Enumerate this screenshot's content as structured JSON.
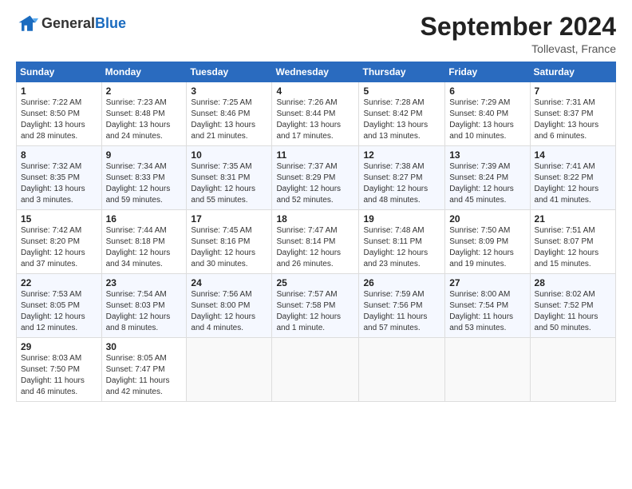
{
  "header": {
    "logo_general": "General",
    "logo_blue": "Blue",
    "month_title": "September 2024",
    "location": "Tollevast, France"
  },
  "weekdays": [
    "Sunday",
    "Monday",
    "Tuesday",
    "Wednesday",
    "Thursday",
    "Friday",
    "Saturday"
  ],
  "weeks": [
    [
      {
        "day": "1",
        "lines": [
          "Sunrise: 7:22 AM",
          "Sunset: 8:50 PM",
          "Daylight: 13 hours",
          "and 28 minutes."
        ]
      },
      {
        "day": "2",
        "lines": [
          "Sunrise: 7:23 AM",
          "Sunset: 8:48 PM",
          "Daylight: 13 hours",
          "and 24 minutes."
        ]
      },
      {
        "day": "3",
        "lines": [
          "Sunrise: 7:25 AM",
          "Sunset: 8:46 PM",
          "Daylight: 13 hours",
          "and 21 minutes."
        ]
      },
      {
        "day": "4",
        "lines": [
          "Sunrise: 7:26 AM",
          "Sunset: 8:44 PM",
          "Daylight: 13 hours",
          "and 17 minutes."
        ]
      },
      {
        "day": "5",
        "lines": [
          "Sunrise: 7:28 AM",
          "Sunset: 8:42 PM",
          "Daylight: 13 hours",
          "and 13 minutes."
        ]
      },
      {
        "day": "6",
        "lines": [
          "Sunrise: 7:29 AM",
          "Sunset: 8:40 PM",
          "Daylight: 13 hours",
          "and 10 minutes."
        ]
      },
      {
        "day": "7",
        "lines": [
          "Sunrise: 7:31 AM",
          "Sunset: 8:37 PM",
          "Daylight: 13 hours",
          "and 6 minutes."
        ]
      }
    ],
    [
      {
        "day": "8",
        "lines": [
          "Sunrise: 7:32 AM",
          "Sunset: 8:35 PM",
          "Daylight: 13 hours",
          "and 3 minutes."
        ]
      },
      {
        "day": "9",
        "lines": [
          "Sunrise: 7:34 AM",
          "Sunset: 8:33 PM",
          "Daylight: 12 hours",
          "and 59 minutes."
        ]
      },
      {
        "day": "10",
        "lines": [
          "Sunrise: 7:35 AM",
          "Sunset: 8:31 PM",
          "Daylight: 12 hours",
          "and 55 minutes."
        ]
      },
      {
        "day": "11",
        "lines": [
          "Sunrise: 7:37 AM",
          "Sunset: 8:29 PM",
          "Daylight: 12 hours",
          "and 52 minutes."
        ]
      },
      {
        "day": "12",
        "lines": [
          "Sunrise: 7:38 AM",
          "Sunset: 8:27 PM",
          "Daylight: 12 hours",
          "and 48 minutes."
        ]
      },
      {
        "day": "13",
        "lines": [
          "Sunrise: 7:39 AM",
          "Sunset: 8:24 PM",
          "Daylight: 12 hours",
          "and 45 minutes."
        ]
      },
      {
        "day": "14",
        "lines": [
          "Sunrise: 7:41 AM",
          "Sunset: 8:22 PM",
          "Daylight: 12 hours",
          "and 41 minutes."
        ]
      }
    ],
    [
      {
        "day": "15",
        "lines": [
          "Sunrise: 7:42 AM",
          "Sunset: 8:20 PM",
          "Daylight: 12 hours",
          "and 37 minutes."
        ]
      },
      {
        "day": "16",
        "lines": [
          "Sunrise: 7:44 AM",
          "Sunset: 8:18 PM",
          "Daylight: 12 hours",
          "and 34 minutes."
        ]
      },
      {
        "day": "17",
        "lines": [
          "Sunrise: 7:45 AM",
          "Sunset: 8:16 PM",
          "Daylight: 12 hours",
          "and 30 minutes."
        ]
      },
      {
        "day": "18",
        "lines": [
          "Sunrise: 7:47 AM",
          "Sunset: 8:14 PM",
          "Daylight: 12 hours",
          "and 26 minutes."
        ]
      },
      {
        "day": "19",
        "lines": [
          "Sunrise: 7:48 AM",
          "Sunset: 8:11 PM",
          "Daylight: 12 hours",
          "and 23 minutes."
        ]
      },
      {
        "day": "20",
        "lines": [
          "Sunrise: 7:50 AM",
          "Sunset: 8:09 PM",
          "Daylight: 12 hours",
          "and 19 minutes."
        ]
      },
      {
        "day": "21",
        "lines": [
          "Sunrise: 7:51 AM",
          "Sunset: 8:07 PM",
          "Daylight: 12 hours",
          "and 15 minutes."
        ]
      }
    ],
    [
      {
        "day": "22",
        "lines": [
          "Sunrise: 7:53 AM",
          "Sunset: 8:05 PM",
          "Daylight: 12 hours",
          "and 12 minutes."
        ]
      },
      {
        "day": "23",
        "lines": [
          "Sunrise: 7:54 AM",
          "Sunset: 8:03 PM",
          "Daylight: 12 hours",
          "and 8 minutes."
        ]
      },
      {
        "day": "24",
        "lines": [
          "Sunrise: 7:56 AM",
          "Sunset: 8:00 PM",
          "Daylight: 12 hours",
          "and 4 minutes."
        ]
      },
      {
        "day": "25",
        "lines": [
          "Sunrise: 7:57 AM",
          "Sunset: 7:58 PM",
          "Daylight: 12 hours",
          "and 1 minute."
        ]
      },
      {
        "day": "26",
        "lines": [
          "Sunrise: 7:59 AM",
          "Sunset: 7:56 PM",
          "Daylight: 11 hours",
          "and 57 minutes."
        ]
      },
      {
        "day": "27",
        "lines": [
          "Sunrise: 8:00 AM",
          "Sunset: 7:54 PM",
          "Daylight: 11 hours",
          "and 53 minutes."
        ]
      },
      {
        "day": "28",
        "lines": [
          "Sunrise: 8:02 AM",
          "Sunset: 7:52 PM",
          "Daylight: 11 hours",
          "and 50 minutes."
        ]
      }
    ],
    [
      {
        "day": "29",
        "lines": [
          "Sunrise: 8:03 AM",
          "Sunset: 7:50 PM",
          "Daylight: 11 hours",
          "and 46 minutes."
        ]
      },
      {
        "day": "30",
        "lines": [
          "Sunrise: 8:05 AM",
          "Sunset: 7:47 PM",
          "Daylight: 11 hours",
          "and 42 minutes."
        ]
      },
      {
        "day": "",
        "lines": []
      },
      {
        "day": "",
        "lines": []
      },
      {
        "day": "",
        "lines": []
      },
      {
        "day": "",
        "lines": []
      },
      {
        "day": "",
        "lines": []
      }
    ]
  ]
}
